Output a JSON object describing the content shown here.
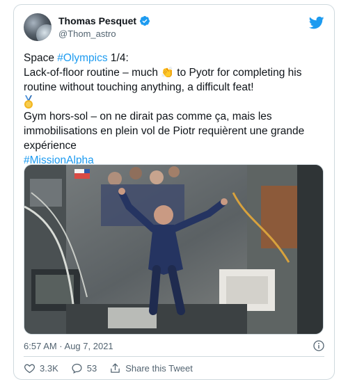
{
  "author": {
    "name": "Thomas Pesquet",
    "handle": "@Thom_astro"
  },
  "tweet": {
    "line1_prefix": "Space ",
    "line1_hashtag": "#Olympics",
    "line1_suffix": " 1/4:",
    "line2_prefix": "Lack-of-floor routine – much ",
    "clap_emoji": "👏",
    "line2_suffix": " to Pyotr for completing his routine without touching anything, a difficult feat!",
    "medal_icon": "gold-medal",
    "fr_text": "Gym hors-sol – on ne dirait pas comme ça, mais les immobilisations en plein vol de Piotr requièrent une grande expérience",
    "hashtag2": "#MissionAlpha"
  },
  "meta": {
    "timestamp": "6:57 AM · Aug 7, 2021"
  },
  "actions": {
    "likes": "3.3K",
    "replies": "53",
    "share_label": "Share this Tweet"
  },
  "colors": {
    "accent": "#1d9bf0",
    "text": "#0f1419",
    "muted": "#536471",
    "border": "#cfd9de"
  }
}
